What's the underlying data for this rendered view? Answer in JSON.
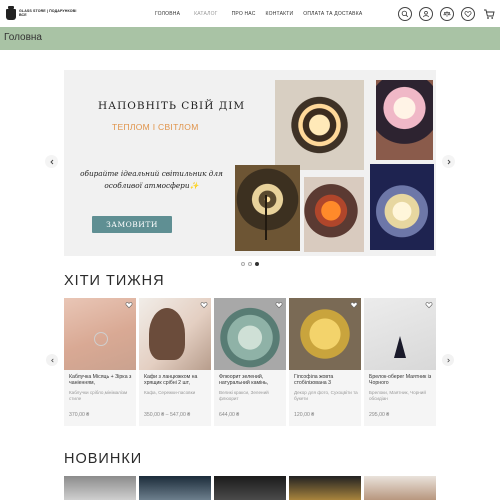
{
  "header": {
    "logo_text_line1": "GLASS STORE | ПОДАРУНКОВІ",
    "logo_text_line2": "ВСЕ",
    "nav": [
      {
        "label": "ГОЛОВНА"
      },
      {
        "label": "КАТАЛОГ"
      },
      {
        "label": "ПРО НАС"
      },
      {
        "label": "КОНТАКТИ"
      },
      {
        "label": "ОПЛАТА ТА ДОСТАВКА"
      }
    ],
    "icons": [
      "search-icon",
      "user-icon",
      "scales-icon",
      "heart-icon",
      "cart-icon"
    ]
  },
  "page_title": "Головна",
  "hero": {
    "title": "НАПОВНІТЬ СВІЙ ДІМ",
    "subtitle": "ТЕПЛОМ І СВІТЛОМ",
    "text_line1": "обирайте  ідеальний світильник для",
    "text_line2": "особливої атмосфери✨",
    "button": "ЗАМОВИТИ",
    "slides": 3,
    "active_slide": 3
  },
  "hits": {
    "title": "ХІТИ ТИЖНЯ",
    "products": [
      {
        "name": "Каблучка Місяць + Зірка з чаніенням,",
        "category": "Каблучки срібло,мінімалізм стиле",
        "price": "370,00 ₴"
      },
      {
        "name": "Кафи з ланцюжком на хрящик срібні 2 шт,",
        "category": "Кафа, Сережки-пасовки",
        "price": "350,00 ₴ – 547,00 ₴"
      },
      {
        "name": "Флюорит зелений, натуральний камінь,",
        "category": "Великі кракси, Зелений флюорит",
        "price": "644,00 ₴"
      },
      {
        "name": "Гіпсофіла жовта стобілізована 3",
        "category": "Декор для фото, Сухоцвіти та букети",
        "price": "120,00 ₴"
      },
      {
        "name": "Брелок-оберег Маятник із Чорного",
        "category": "Брелоки, Маятник, Чорний обсидіан",
        "price": "295,00 ₴"
      }
    ]
  },
  "new": {
    "title": "НОВИНКИ"
  },
  "colors": {
    "title_bar": "#a9c3a5",
    "button": "#5f8f93",
    "hero_accent": "#e0944b"
  }
}
